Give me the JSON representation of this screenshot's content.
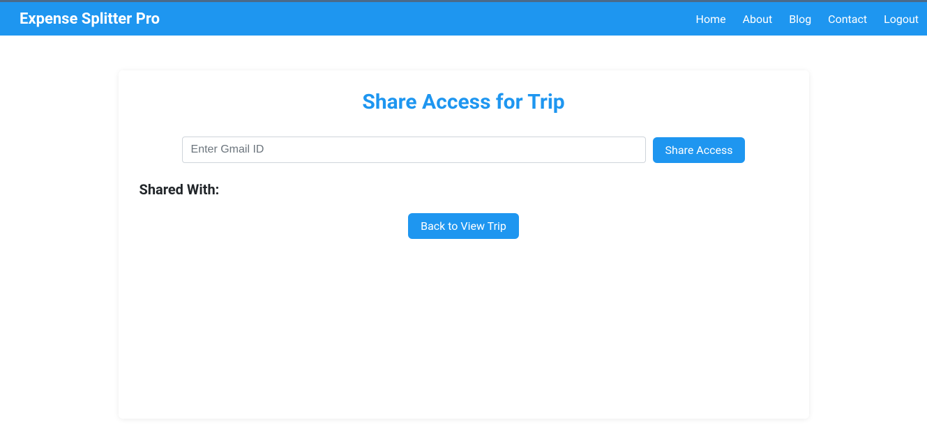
{
  "navbar": {
    "brand": "Expense Splitter Pro",
    "links": {
      "home": "Home",
      "about": "About",
      "blog": "Blog",
      "contact": "Contact",
      "logout": "Logout"
    }
  },
  "page": {
    "title": "Share Access for Trip"
  },
  "form": {
    "email_placeholder": "Enter Gmail ID",
    "email_value": "",
    "share_button": "Share Access"
  },
  "shared": {
    "label": "Shared With:"
  },
  "back": {
    "label": "Back to View Trip"
  }
}
